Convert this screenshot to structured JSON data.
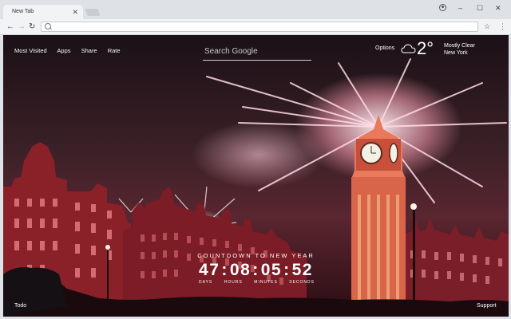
{
  "browser": {
    "tab_title": "New Tab",
    "tab_close": "✕",
    "window_controls": {
      "minimize": "–",
      "maximize": "☐",
      "close": "✕"
    },
    "omnibox_value": ""
  },
  "newtab": {
    "nav_links": [
      "Most Visited",
      "Apps",
      "Share",
      "Rate"
    ],
    "search_placeholder": "Search Google",
    "options_label": "Options",
    "weather": {
      "temperature": "2°",
      "condition": "Mostly Clear",
      "location": "New York",
      "icon": "cloud-icon"
    },
    "countdown": {
      "title": "COUNTDOWN TO NEW YEAR",
      "days": "47",
      "hours": "08",
      "minutes": "05",
      "seconds": "52",
      "units": [
        "DAYS",
        "HOURS",
        "MINUTES",
        "SECONDS"
      ]
    },
    "todo_label": "Todo",
    "support_label": "Support"
  }
}
